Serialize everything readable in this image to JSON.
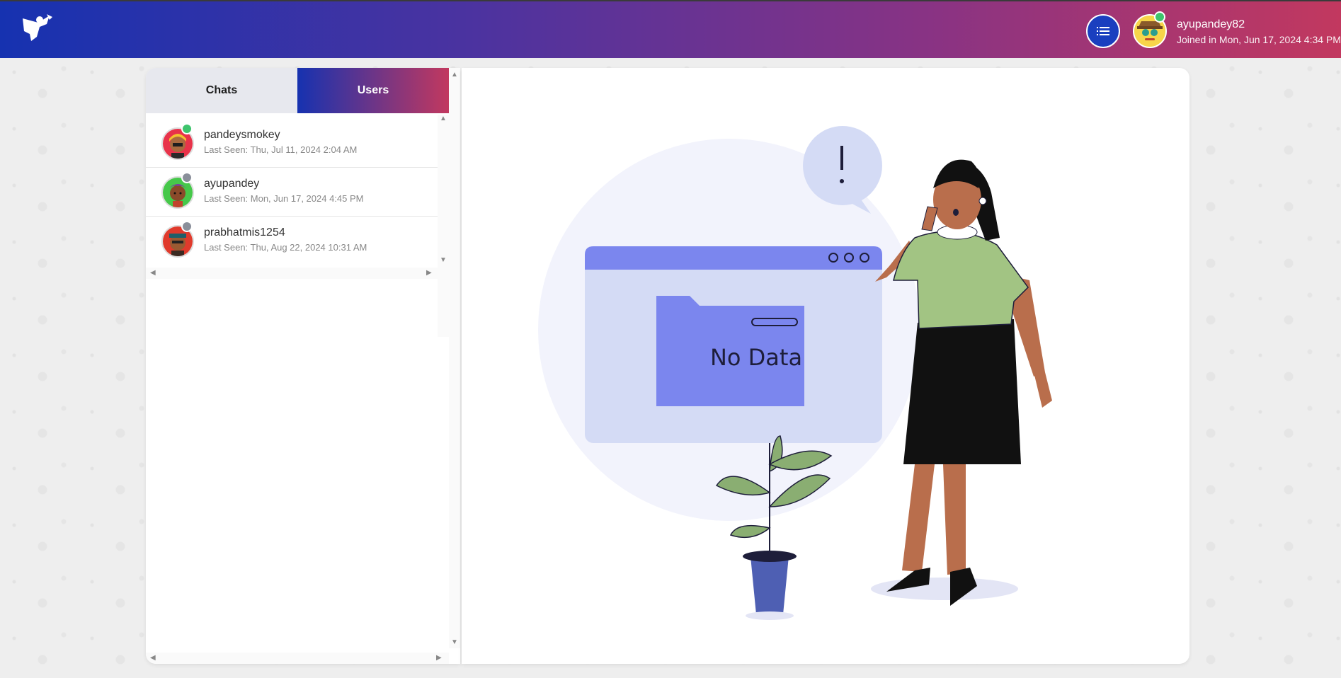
{
  "header": {
    "username": "ayupandey82",
    "joined": "Joined in Mon, Jun 17, 2024 4:34 PM",
    "online_color": "#3ec46d",
    "menu_icon": "list-icon",
    "logo_icon": "superhero-logo-icon"
  },
  "tabs": [
    {
      "label": "Chats",
      "active": false
    },
    {
      "label": "Users",
      "active": true
    }
  ],
  "users": [
    {
      "name": "pandeysmokey",
      "last_seen": "Last Seen: Thu, Jul 11, 2024 2:04 AM",
      "status": "online",
      "avatar_color": "#e8334a"
    },
    {
      "name": "ayupandey",
      "last_seen": "Last Seen: Mon, Jun 17, 2024 4:45 PM",
      "status": "offline",
      "avatar_color": "#46c84a"
    },
    {
      "name": "prabhatmis1254",
      "last_seen": "Last Seen: Thu, Aug 22, 2024 10:31 AM",
      "status": "offline",
      "avatar_color": "#e03a2c"
    }
  ],
  "status_colors": {
    "online": "#3ec46d",
    "offline": "#8a8f9a"
  },
  "empty_state": {
    "text": "No Data",
    "accent": "#7b86ee"
  }
}
